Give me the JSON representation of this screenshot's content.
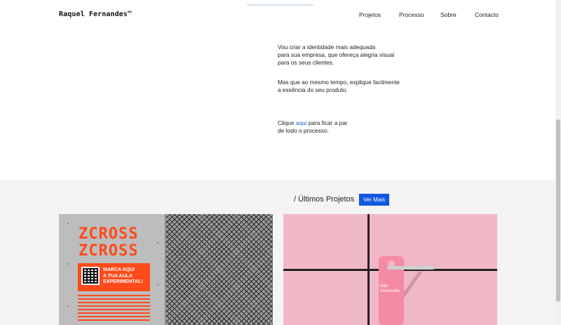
{
  "header": {
    "logo": "Raquel Fernandes™",
    "nav": [
      "Projetos",
      "Processo",
      "Sobre",
      "Contacto"
    ]
  },
  "intro": {
    "p1": [
      "Vou criar a identidade mais adequada",
      "para sua empresa, que ofereça alegria visual",
      "para os seus clientes."
    ],
    "p2": [
      "Mas que ao mesmo tempo, explique facilmente",
      "a essência do seu produto."
    ],
    "p3_before": "Clique ",
    "p3_link": "aqui",
    "p3_after": " para ficar a par",
    "p3_line2": "de todo o processo."
  },
  "projects": {
    "title": "/ Últimos Projetos",
    "button": "Ver Mais",
    "cards": [
      {
        "brand": "ZCROSS",
        "poster": [
          "MARCA AQUI",
          "A TUA AULA",
          "EXPERIMENTAL!"
        ]
      },
      {
        "sign": [
          "Não",
          "incomodar"
        ]
      }
    ]
  },
  "colors": {
    "accent": "#1357e0",
    "link": "#1565d8",
    "orange": "#ff4a1c",
    "pink": "#f0b8c6"
  }
}
